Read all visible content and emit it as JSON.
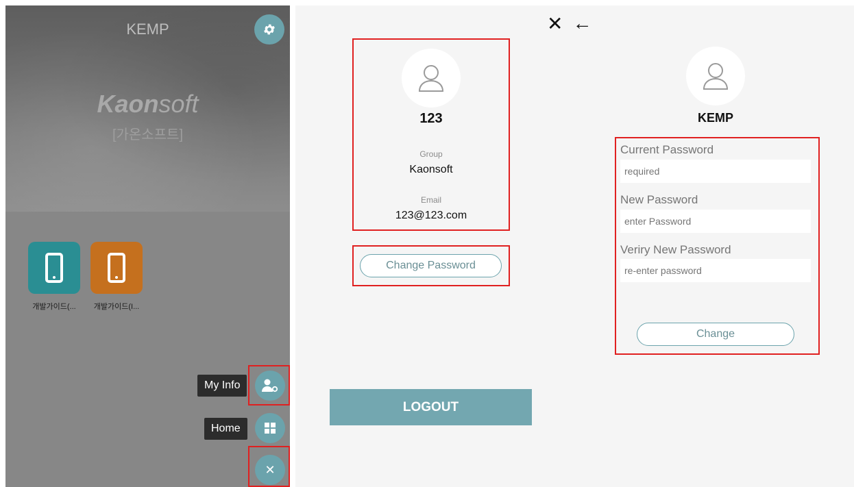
{
  "phone": {
    "app_title": "KEMP",
    "brand_bold": "Kaon",
    "brand_light": "soft",
    "brand_sub": "[가온소프트]",
    "apps": [
      {
        "label": "개발가이드(...",
        "color": "#2a8e93"
      },
      {
        "label": "개발가이드(I...",
        "color": "#c5701e"
      }
    ],
    "fab_menu": {
      "my_info_label": "My Info",
      "home_label": "Home"
    },
    "accent_color": "#6ba3ac"
  },
  "icons": {
    "close": "✕",
    "back": "←",
    "settings": "gear-icon",
    "home": "grid-icon",
    "my_info": "user-settings-icon",
    "fab_close": "✕"
  },
  "profile": {
    "name": "123",
    "group_label": "Group",
    "group_value": "Kaonsoft",
    "email_label": "Email",
    "email_value": "123@123.com",
    "change_password_label": "Change Password",
    "logout_label": "LOGOUT"
  },
  "password_form": {
    "username": "KEMP",
    "current_label": "Current Password",
    "current_placeholder": "required",
    "new_label": "New Password",
    "new_placeholder": "enter Password",
    "verify_label": "Veriry New Password",
    "verify_placeholder": "re-enter password",
    "submit_label": "Change"
  }
}
